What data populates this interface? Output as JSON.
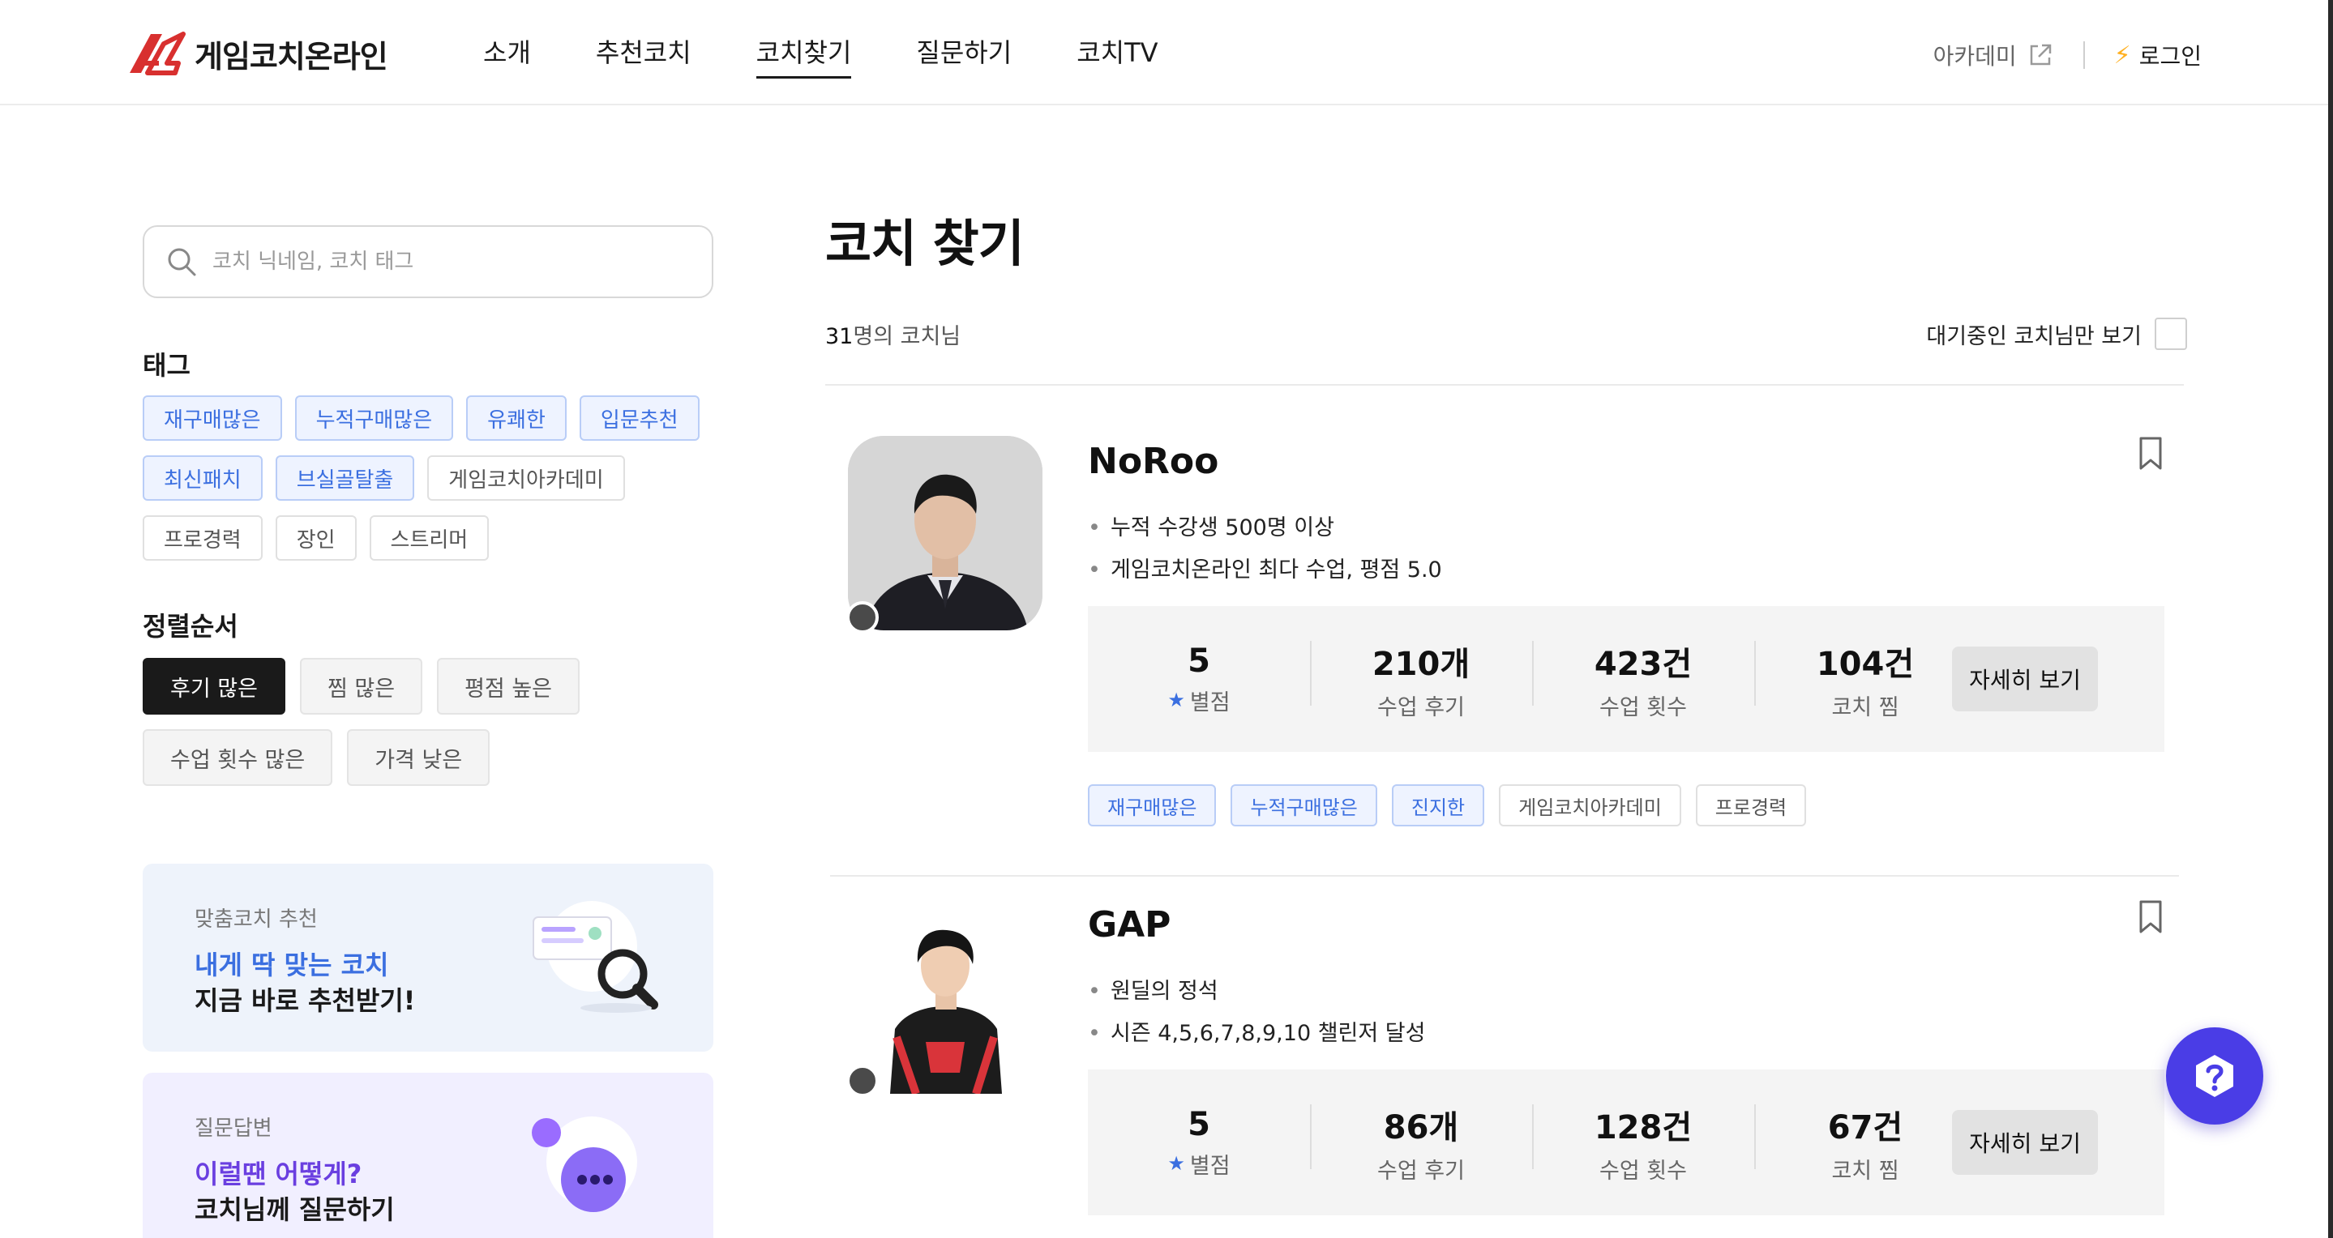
{
  "header": {
    "brand": "게임코치온라인",
    "nav": [
      {
        "label": "소개"
      },
      {
        "label": "추천코치"
      },
      {
        "label": "코치찾기"
      },
      {
        "label": "질문하기"
      },
      {
        "label": "코치TV"
      }
    ],
    "academy_label": "아카데미",
    "login_label": "로그인",
    "colors": {
      "brand_red": "#d8302f",
      "active_underline": "#1a1a1a"
    }
  },
  "sidebar": {
    "search_placeholder": "코치 닉네임, 코치 태그",
    "tags_title": "태그",
    "tags": [
      {
        "label": "재구매많은",
        "style": "blue"
      },
      {
        "label": "누적구매많은",
        "style": "blue"
      },
      {
        "label": "유쾌한",
        "style": "blue"
      },
      {
        "label": "입문추천",
        "style": "blue"
      },
      {
        "label": "최신패치",
        "style": "blue"
      },
      {
        "label": "브실골탈출",
        "style": "blue"
      },
      {
        "label": "게임코치아카데미",
        "style": "gray"
      },
      {
        "label": "프로경력",
        "style": "gray"
      },
      {
        "label": "장인",
        "style": "gray"
      },
      {
        "label": "스트리머",
        "style": "gray"
      }
    ],
    "sort_title": "정렬순서",
    "sorts": [
      {
        "label": "후기 많은",
        "active": true
      },
      {
        "label": "찜 많은",
        "active": false
      },
      {
        "label": "평점 높은",
        "active": false
      },
      {
        "label": "수업 횟수 많은",
        "active": false
      },
      {
        "label": "가격 낮은",
        "active": false
      }
    ],
    "promos": [
      {
        "small": "맞춤코치 추천",
        "line1": "내게 딱 맞는 코치",
        "line2": "지금 바로 추천받기!"
      },
      {
        "small": "질문답변",
        "line1": "이럴땐 어떻게?",
        "line2": "코치님께 질문하기"
      }
    ]
  },
  "main": {
    "title": "코치 찾기",
    "count_number": "31",
    "count_suffix": "명의 코치님",
    "waiting_label": "대기중인 코치님만 보기",
    "coaches": [
      {
        "name": "NoRoo",
        "desc": [
          "누적 수강생 500명 이상",
          "게임코치온라인 최다 수업, 평점 5.0"
        ],
        "stats": [
          {
            "value": "5",
            "label": "별점"
          },
          {
            "value": "210개",
            "label": "수업 후기"
          },
          {
            "value": "423건",
            "label": "수업 횟수"
          },
          {
            "value": "104건",
            "label": "코치 찜"
          }
        ],
        "detail_label": "자세히 보기",
        "tags": [
          {
            "label": "재구매많은",
            "style": "blue"
          },
          {
            "label": "누적구매많은",
            "style": "blue"
          },
          {
            "label": "진지한",
            "style": "blue"
          },
          {
            "label": "게임코치아카데미",
            "style": "gray"
          },
          {
            "label": "프로경력",
            "style": "gray"
          }
        ]
      },
      {
        "name": "GAP",
        "desc": [
          "원딜의 정석",
          "시즌 4,5,6,7,8,9,10 챌린저 달성"
        ],
        "stats": [
          {
            "value": "5",
            "label": "별점"
          },
          {
            "value": "86개",
            "label": "수업 후기"
          },
          {
            "value": "128건",
            "label": "수업 횟수"
          },
          {
            "value": "67건",
            "label": "코치 찜"
          }
        ],
        "detail_label": "자세히 보기"
      }
    ]
  },
  "icons": {
    "search": "search-icon",
    "external": "external-link-icon",
    "bolt": "lightning-icon",
    "bookmark": "bookmark-icon",
    "star": "star-icon",
    "help": "help-question-icon"
  }
}
